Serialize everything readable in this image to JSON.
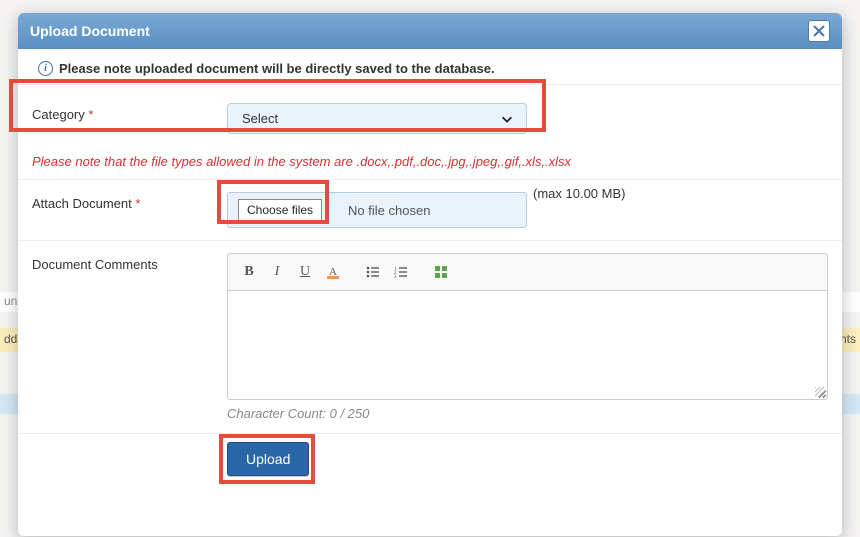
{
  "modal": {
    "title": "Upload Document",
    "notice": "Please note uploaded document will be directly saved to the database.",
    "filetypes_note": "Please note that the file types allowed in the system are .docx,.pdf,.doc,.jpg,.jpeg,.gif,.xls,.xlsx",
    "category": {
      "label": "Category",
      "selected": "Select"
    },
    "attach": {
      "label": "Attach Document",
      "choose_label": "Choose files",
      "status": "No file chosen",
      "max_note": "(max 10.00 MB)"
    },
    "comments": {
      "label": "Document Comments",
      "char_count": "Character Count: 0 / 250"
    },
    "upload_label": "Upload"
  },
  "bg": {
    "truncated_left": "un.c",
    "row_left": "dd",
    "row_right": "ents"
  }
}
